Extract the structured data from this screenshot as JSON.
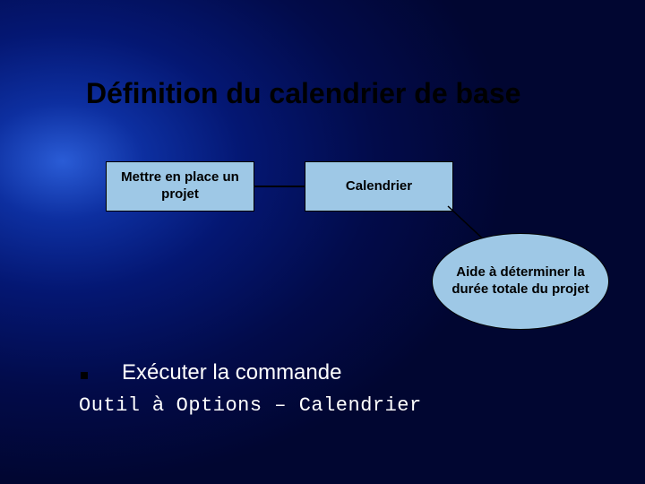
{
  "slide": {
    "title": "Définition du calendrier de base",
    "box1": "Mettre en place un projet",
    "box2": "Calendrier",
    "callout": "Aide à déterminer la durée totale du projet",
    "bullet": "Exécuter la commande",
    "command_part1": "Outil ",
    "command_arrow": "à",
    "command_part2": " Options – Calendrier"
  }
}
